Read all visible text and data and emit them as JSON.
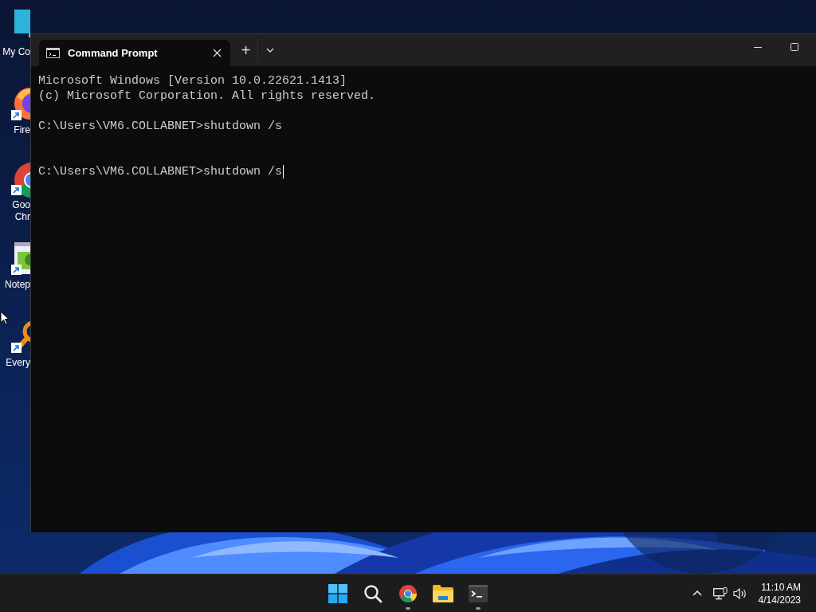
{
  "desktop": {
    "icons": [
      {
        "kind": "monitor",
        "label": [
          "My Co"
        ]
      },
      {
        "kind": "firefox",
        "label": [
          "Fire"
        ]
      },
      {
        "kind": "chrome",
        "label": [
          "Goo",
          "Chr"
        ]
      },
      {
        "kind": "notepad",
        "label": [
          "Notep"
        ]
      },
      {
        "kind": "everything",
        "label": [
          "Every"
        ]
      }
    ]
  },
  "window": {
    "tabs": [
      {
        "title": "Command Prompt",
        "selected": true
      }
    ],
    "new_tab": "+"
  },
  "terminal": {
    "banner": [
      "Microsoft Windows [Version 10.0.22621.1413]",
      "(c) Microsoft Corporation. All rights reserved."
    ],
    "commands": [
      {
        "text": "C:\\Users\\VM6.COLLABNET>shutdown /s",
        "cursor": false
      },
      {
        "text": "C:\\Users\\VM6.COLLABNET>shutdown /s",
        "cursor": true
      }
    ]
  },
  "taskbar": {
    "apps": [
      {
        "kind": "start",
        "running": false
      },
      {
        "kind": "search",
        "running": false
      },
      {
        "kind": "chrome",
        "running": true
      },
      {
        "kind": "explorer",
        "running": false
      },
      {
        "kind": "terminal",
        "running": true
      }
    ],
    "time": "11:10 AM",
    "date": "4/14/2023"
  }
}
